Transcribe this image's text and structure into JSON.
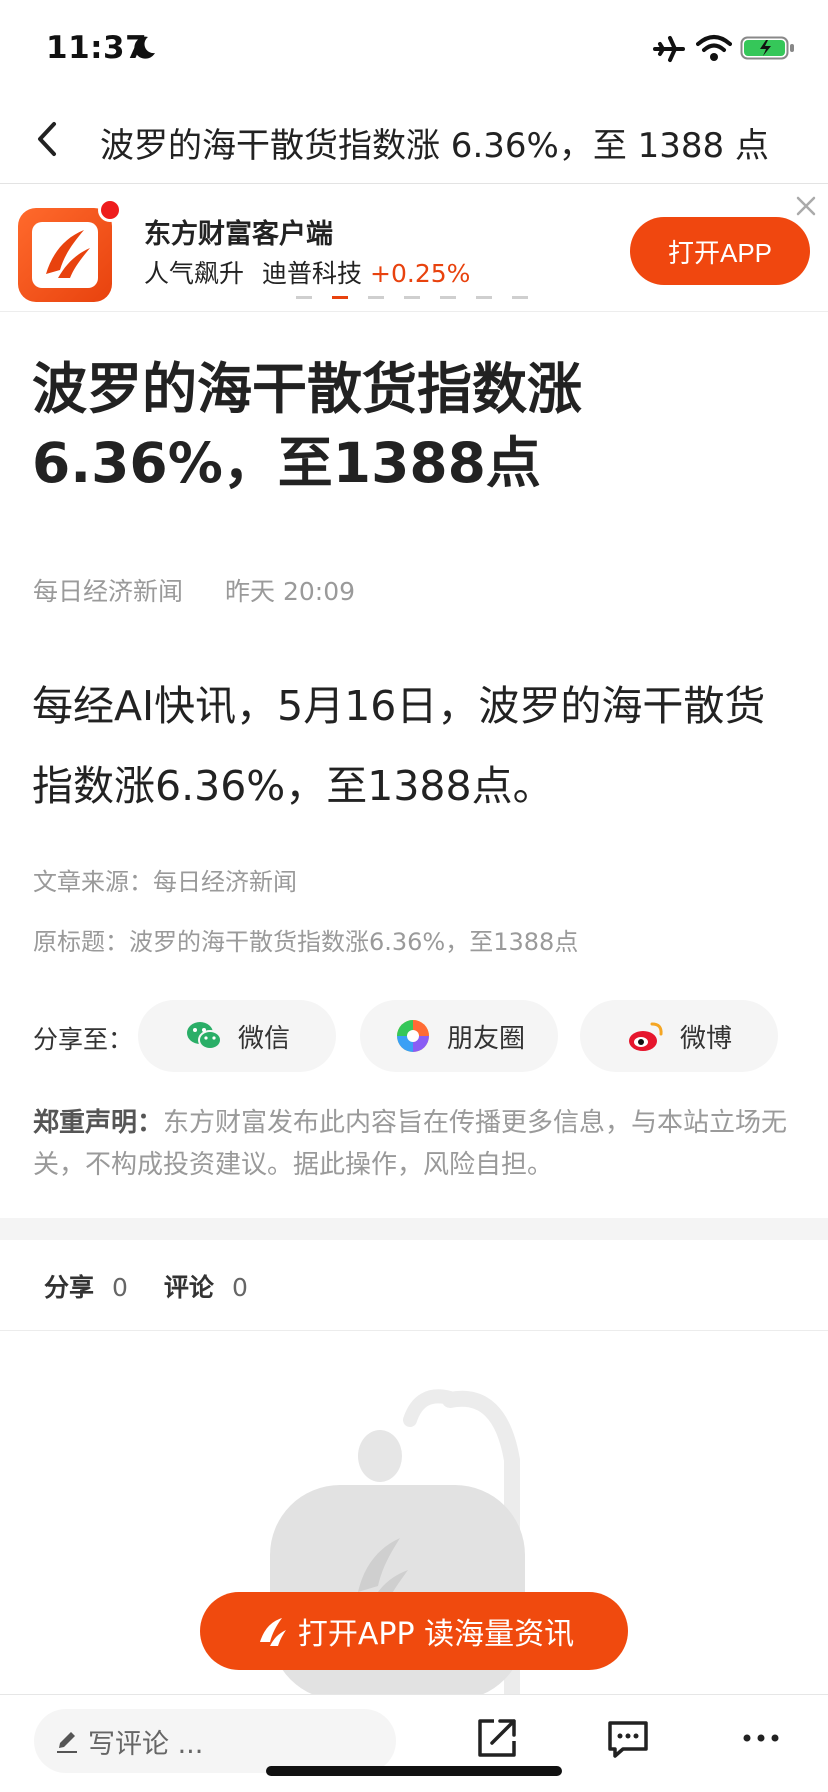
{
  "status_bar": {
    "time": "11:37"
  },
  "nav": {
    "title": "波罗的海干散货指数涨 6.36%，至 1388 点"
  },
  "banner": {
    "app_name": "东方财富客户端",
    "ticker_label": "人气飙升",
    "ticker_stock": "迪普科技",
    "ticker_change": "+0.25%",
    "open_label": "打开APP"
  },
  "article": {
    "title": "波罗的海干散货指数涨 6.36%，至1388点",
    "source_name": "每日经济新闻",
    "time": "昨天 20:09",
    "body": "每经AI快讯，5月16日，波罗的海干散货指数涨6.36%，至1388点。",
    "source_line": "文章来源：每日经济新闻",
    "orig_title": "原标题：波罗的海干散货指数涨6.36%，至1388点"
  },
  "share": {
    "label": "分享至：",
    "wechat": "微信",
    "moments": "朋友圈",
    "weibo": "微博"
  },
  "disclaimer": {
    "heading": "郑重声明：",
    "text": "东方财富发布此内容旨在传播更多信息，与本站立场无关，不构成投资建议。据此操作，风险自担。"
  },
  "counts": {
    "share_label": "分享",
    "share_count": "0",
    "comment_label": "评论",
    "comment_count": "0"
  },
  "float_button": {
    "label": "打开APP 读海量资讯"
  },
  "bottom_bar": {
    "comment_placeholder": "写评论 ..."
  },
  "colors": {
    "accent": "#f04a0e",
    "price_up": "#e8420e"
  }
}
